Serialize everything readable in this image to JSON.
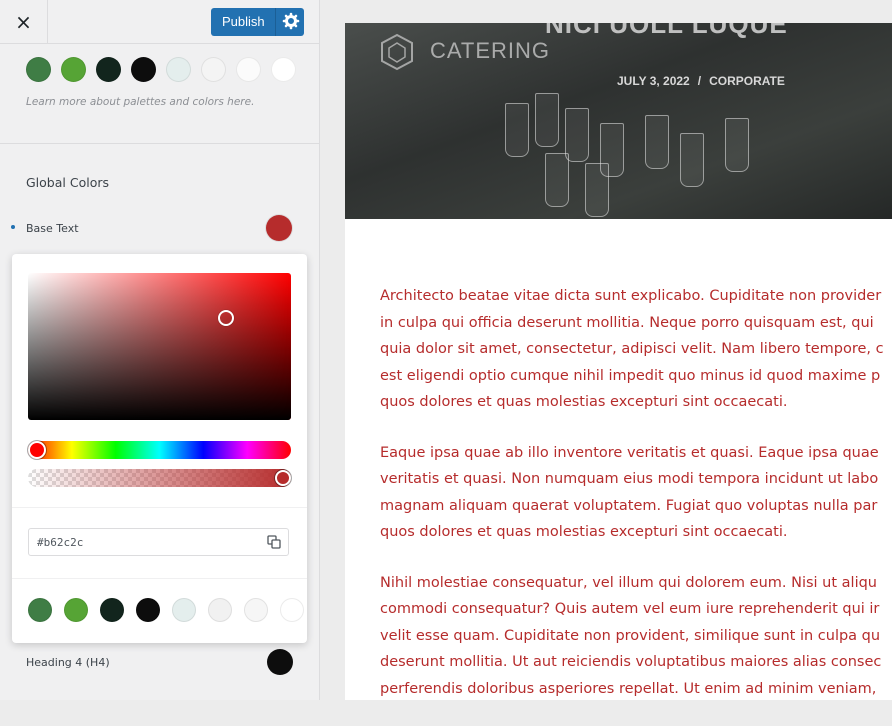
{
  "header": {
    "close_label": "×",
    "publish_label": "Publish"
  },
  "palette_top": {
    "swatches": [
      "#3f7d45",
      "#56a435",
      "#12251d",
      "#0d0d0d",
      "#e4eeed",
      "#f4f4f4",
      "#fbfbfb",
      "#ffffff"
    ],
    "learn_more": "Learn more about palettes and colors here."
  },
  "global_colors": {
    "title": "Global Colors",
    "base_text_label": "Base Text",
    "base_text_color": "#b62c2c",
    "heading4_label": "Heading 4 (H4)",
    "heading4_color": "#0d0d0d"
  },
  "picker": {
    "hex_value": "#b62c2c",
    "hue": "red",
    "alpha": 1,
    "palette": [
      "#3f7d45",
      "#56a435",
      "#12251d",
      "#0d0d0d",
      "#e4eeed",
      "#f1f1f1",
      "#f6f6f6",
      "#ffffff"
    ]
  },
  "preview": {
    "hero_title": "NICI UOLL LUQUE",
    "logo_text": "CATERING",
    "post_date": "JULY 3, 2022",
    "post_separator": "/",
    "post_category": "CORPORATE",
    "paragraphs": [
      [
        "Architecto beatae vitae dicta sunt explicabo. Cupiditate non provider",
        "in culpa qui officia deserunt mollitia. Neque porro quisquam est, qui",
        "quia dolor sit amet, consectetur, adipisci velit. Nam libero tempore, c",
        "est eligendi optio cumque nihil impedit quo minus id quod maxime p",
        "quos dolores et quas molestias excepturi sint occaecati."
      ],
      [
        "Eaque ipsa quae ab illo inventore veritatis et quasi. Eaque ipsa quae",
        "veritatis et quasi. Non numquam eius modi tempora incidunt ut labo",
        "magnam aliquam quaerat voluptatem. Fugiat quo voluptas nulla par",
        "quos dolores et quas molestias excepturi sint occaecati."
      ],
      [
        "Nihil molestiae consequatur, vel illum qui dolorem eum. Nisi ut aliqu",
        "commodi consequatur? Quis autem vel eum iure reprehenderit qui ir",
        "velit esse quam. Cupiditate non provident, similique sunt in culpa qu",
        "deserunt mollitia. Ut aut reiciendis voluptatibus maiores alias consec",
        "perferendis doloribus asperiores repellat. Ut enim ad minim veniam,"
      ]
    ]
  }
}
